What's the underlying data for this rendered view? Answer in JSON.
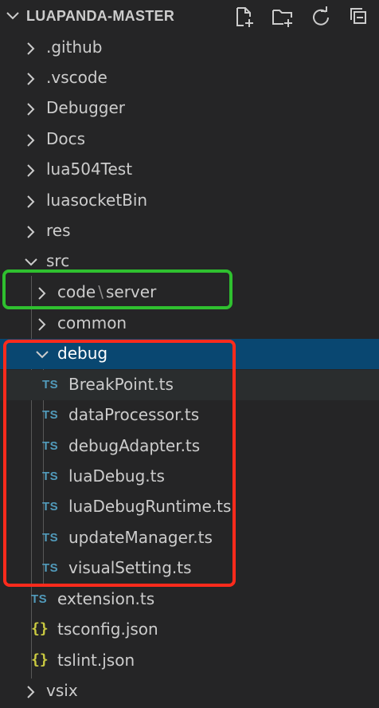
{
  "header": {
    "title": "LUAPANDA-MASTER",
    "actions": [
      {
        "icon": "new-file-icon"
      },
      {
        "icon": "new-folder-icon"
      },
      {
        "icon": "refresh-icon"
      },
      {
        "icon": "collapse-all-icon"
      }
    ]
  },
  "tree": {
    "github": ".github",
    "vscode": ".vscode",
    "debugger": "Debugger",
    "docs": "Docs",
    "lua504test": "lua504Test",
    "luasocketbin": "luasocketBin",
    "res": "res",
    "src": "src",
    "code": "code",
    "code_sep": "\\",
    "server": "server",
    "common": "common",
    "debug": "debug",
    "breakpoint": "BreakPoint.ts",
    "dataprocessor": "dataProcessor.ts",
    "debugadapter": "debugAdapter.ts",
    "luadebug": "luaDebug.ts",
    "luadebugruntime": "luaDebugRuntime.ts",
    "updatemanager": "updateManager.ts",
    "visualsetting": "visualSetting.ts",
    "extension": "extension.ts",
    "tsconfig": "tsconfig.json",
    "tslint": "tslint.json",
    "vsix": "vsix"
  },
  "icons": {
    "ts_badge": "TS",
    "json_badge": "{}"
  },
  "colors": {
    "background": "#252526",
    "selected_row": "#094771",
    "ts_icon": "#519aba",
    "json_icon": "#cbcb41",
    "highlight_green": "#2fc02f",
    "highlight_red": "#ff2b1c"
  }
}
